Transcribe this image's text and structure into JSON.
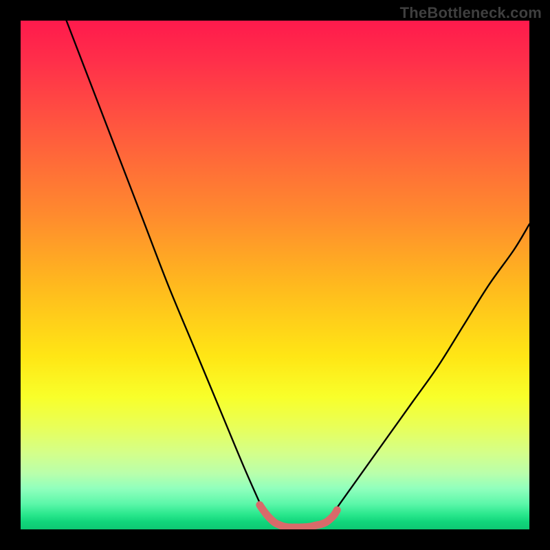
{
  "watermark": "TheBottleneck.com",
  "chart_data": {
    "type": "line",
    "title": "",
    "xlabel": "",
    "ylabel": "",
    "xlim": [
      0,
      100
    ],
    "ylim": [
      0,
      100
    ],
    "grid": false,
    "legend": false,
    "background": "rainbow-vertical-gradient",
    "series": [
      {
        "name": "left-curve",
        "stroke": "#000000",
        "x": [
          9,
          14,
          19,
          24,
          29,
          34,
          39,
          44,
          48
        ],
        "y": [
          100,
          87,
          74,
          61,
          48,
          36,
          24,
          12,
          3
        ]
      },
      {
        "name": "right-curve",
        "stroke": "#000000",
        "x": [
          62,
          67,
          72,
          77,
          82,
          87,
          92,
          97,
          100
        ],
        "y": [
          4,
          11,
          18,
          25,
          32,
          40,
          48,
          55,
          60
        ]
      },
      {
        "name": "valley-segment",
        "stroke": "#d96a6a",
        "x": [
          47.0,
          47.6,
          48.2,
          48.8,
          49.4,
          50.0,
          50.8,
          51.6,
          52.4,
          53.2,
          54.0,
          55.0,
          56.0,
          57.0,
          58.0,
          59.0,
          60.0,
          60.8,
          61.6,
          62.2
        ],
        "y": [
          4.8,
          3.9,
          3.1,
          2.4,
          1.8,
          1.3,
          0.9,
          0.6,
          0.45,
          0.4,
          0.4,
          0.4,
          0.45,
          0.55,
          0.8,
          1.0,
          1.4,
          2.0,
          2.8,
          3.8
        ]
      }
    ]
  }
}
